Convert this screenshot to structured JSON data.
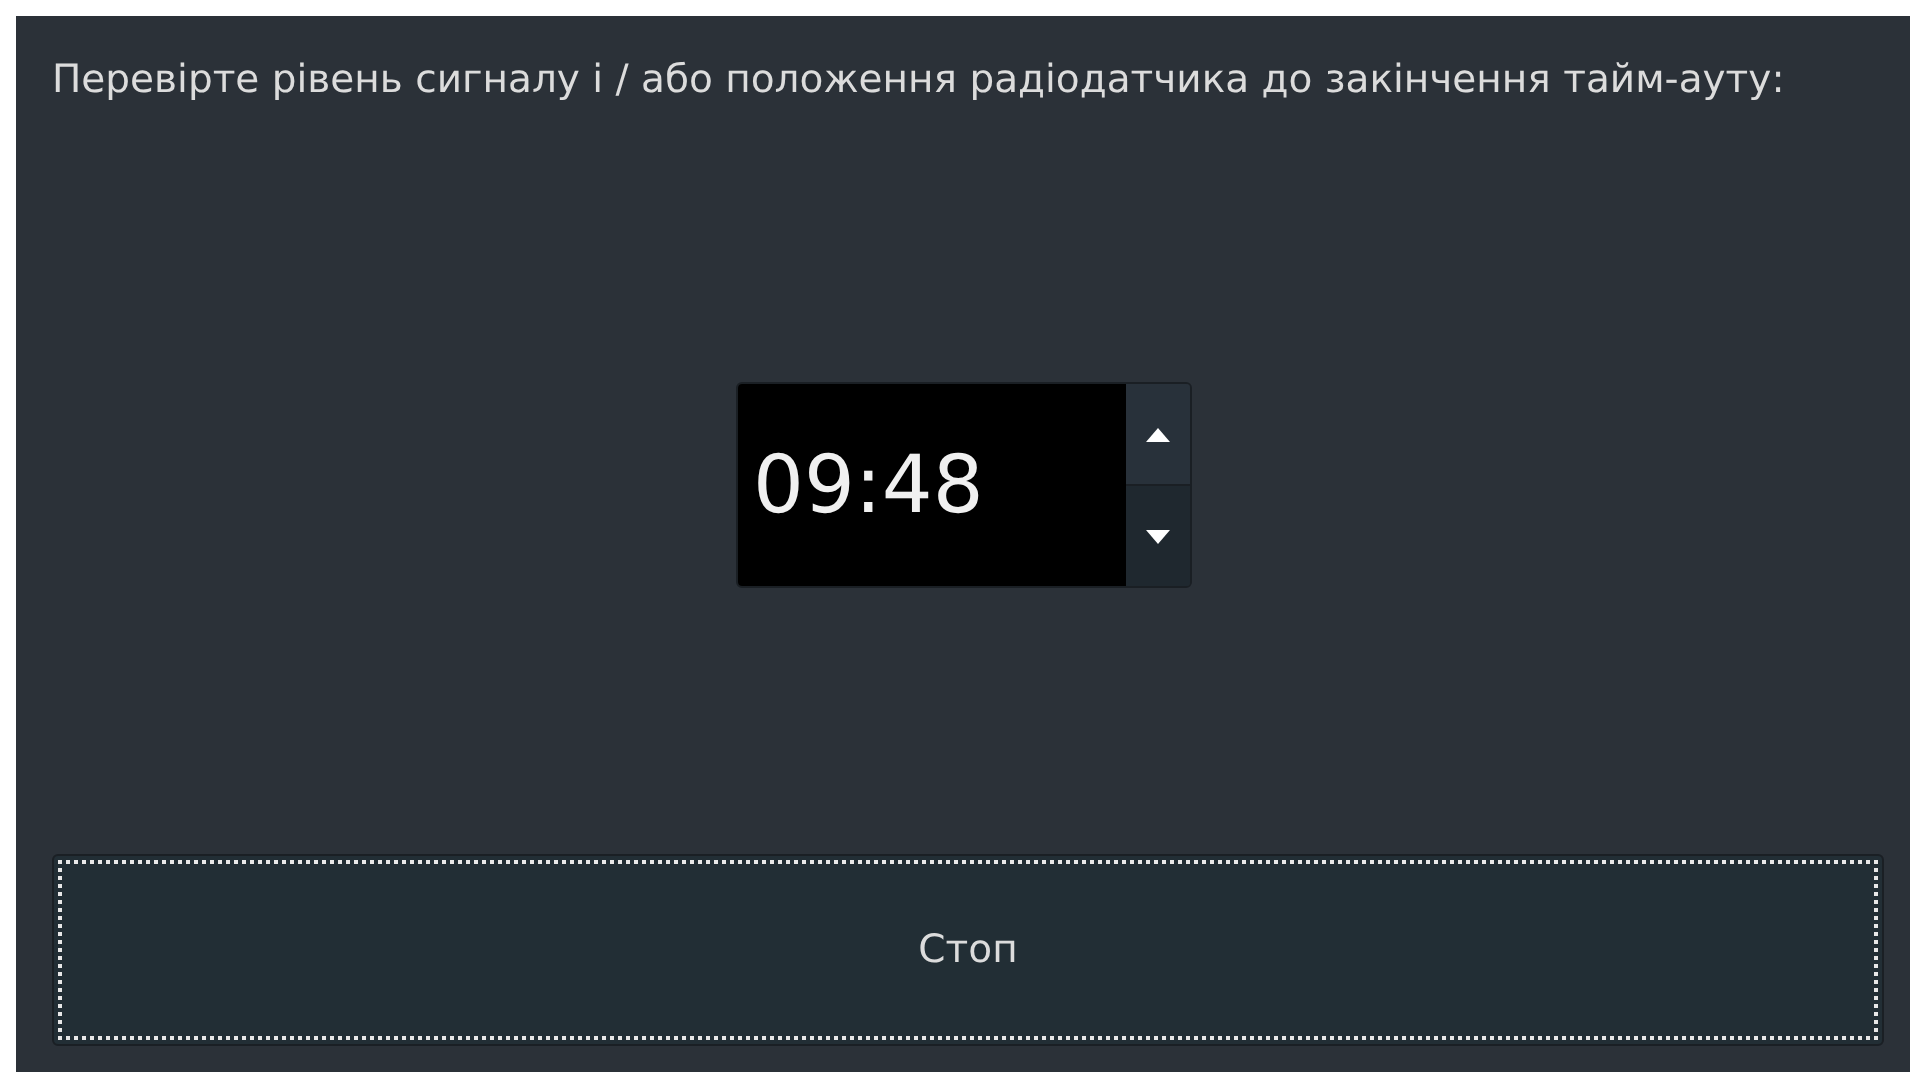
{
  "message": "Перевірте рівень сигналу і / або положення радіодатчика до закінчення тайм-ауту:",
  "timer": {
    "value": "09:48"
  },
  "stop_button": {
    "label": "Стоп",
    "focused": true
  }
}
